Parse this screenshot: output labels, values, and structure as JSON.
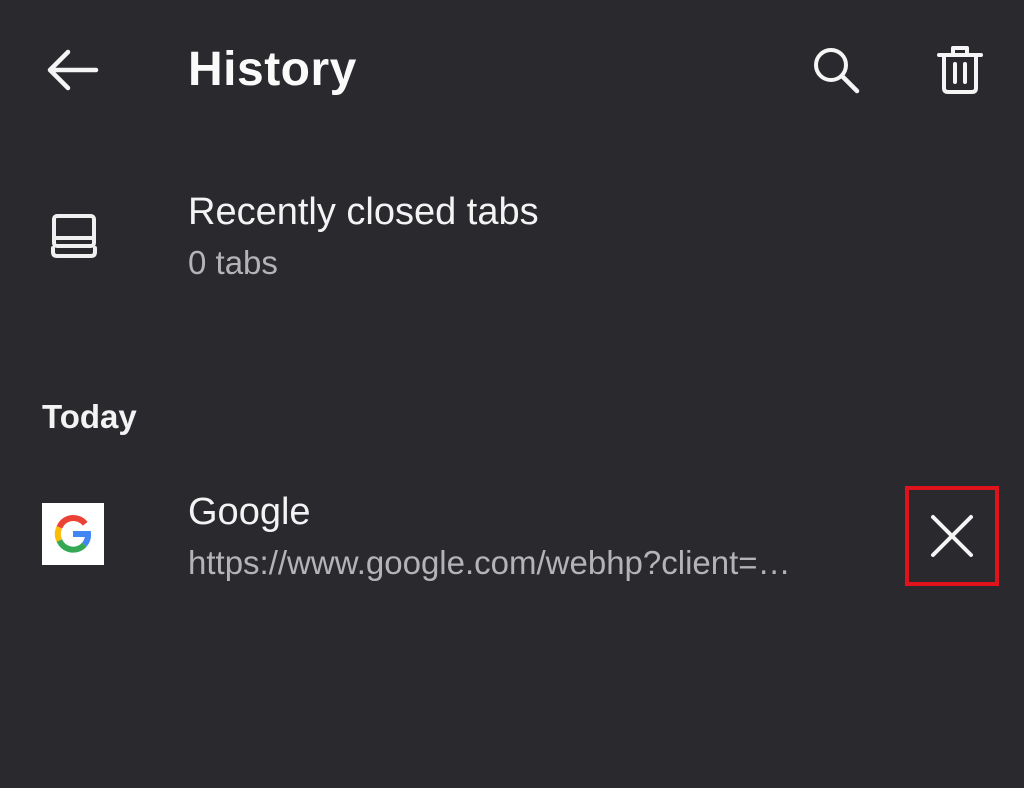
{
  "toolbar": {
    "title": "History",
    "back_icon": "arrow-left-icon",
    "search_icon": "search-icon",
    "delete_icon": "trash-icon"
  },
  "recently_closed": {
    "icon": "tabs-icon",
    "title": "Recently closed tabs",
    "subtitle": "0 tabs"
  },
  "sections": [
    {
      "header": "Today",
      "items": [
        {
          "favicon": "google-g-icon",
          "title": "Google",
          "url": "https://www.google.com/webhp?client=…",
          "remove_icon": "close-icon"
        }
      ]
    }
  ],
  "colors": {
    "background": "#2a292e",
    "primary_text": "#f3f3f3",
    "secondary_text": "#b4b4b8",
    "highlight_box": "#e0121b"
  }
}
